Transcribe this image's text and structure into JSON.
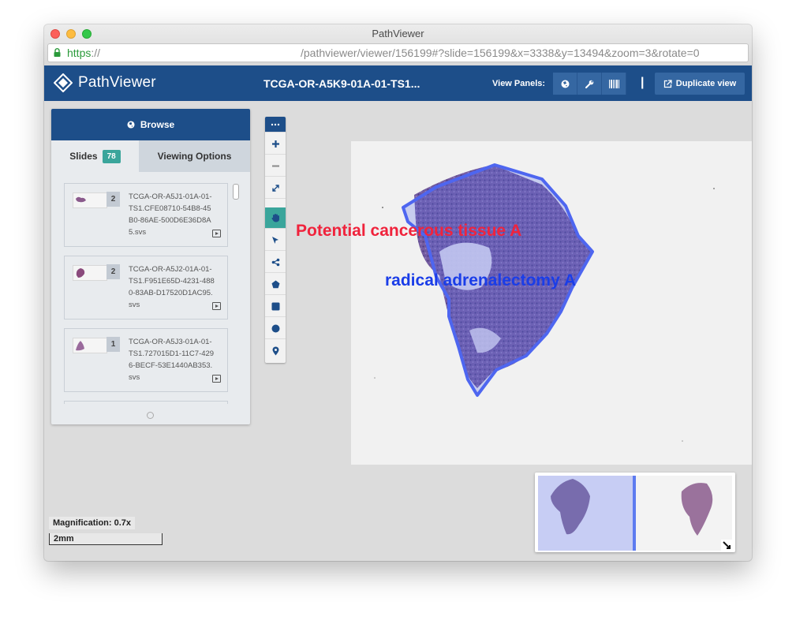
{
  "window": {
    "title": "PathViewer"
  },
  "address_bar": {
    "scheme": "https",
    "scheme_rest": "://",
    "path": "/pathviewer/viewer/156199#?slide=156199&x=3338&y=13494&zoom=3&rotate=0"
  },
  "navbar": {
    "logo_text": "PathViewer",
    "slide_title": "TCGA-OR-A5K9-01A-01-TS1...",
    "view_panels_label": "View Panels:",
    "panel_buttons": [
      "globe-icon",
      "wrench-icon",
      "barcode-icon"
    ],
    "separator": "|",
    "duplicate_label": "Duplicate view",
    "brand_color": "#1d4e89"
  },
  "browse": {
    "title": "Browse",
    "tabs": {
      "slides_label": "Slides",
      "slides_count": "78",
      "options_label": "Viewing Options"
    },
    "items": [
      {
        "count": "2",
        "name": "TCGA-OR-A5J1-01A-01-TS1.CFE08710-54B8-45B0-86AE-500D6E36D8A5.svs"
      },
      {
        "count": "2",
        "name": "TCGA-OR-A5J2-01A-01-TS1.F951E65D-4231-4880-83AB-D17520D1AC95.svs"
      },
      {
        "count": "1",
        "name": "TCGA-OR-A5J3-01A-01-TS1.727015D1-11C7-4296-BECF-53E1440AB353.svs"
      }
    ]
  },
  "tools": [
    "more-icon",
    "zoom-in-icon",
    "zoom-out-icon",
    "fullscreen-icon",
    "pan-hand-icon",
    "select-arrow-icon",
    "share-icon",
    "polygon-icon",
    "rectangle-icon",
    "circle-icon",
    "marker-icon"
  ],
  "annotations": {
    "red_label": "Potential cancerous tissue A",
    "blue_label": "radical adrenalectomy A",
    "red_color": "#f0233c",
    "blue_color": "#1a3de8"
  },
  "status": {
    "magnification": "Magnification: 0.7x",
    "scale": "2mm"
  }
}
